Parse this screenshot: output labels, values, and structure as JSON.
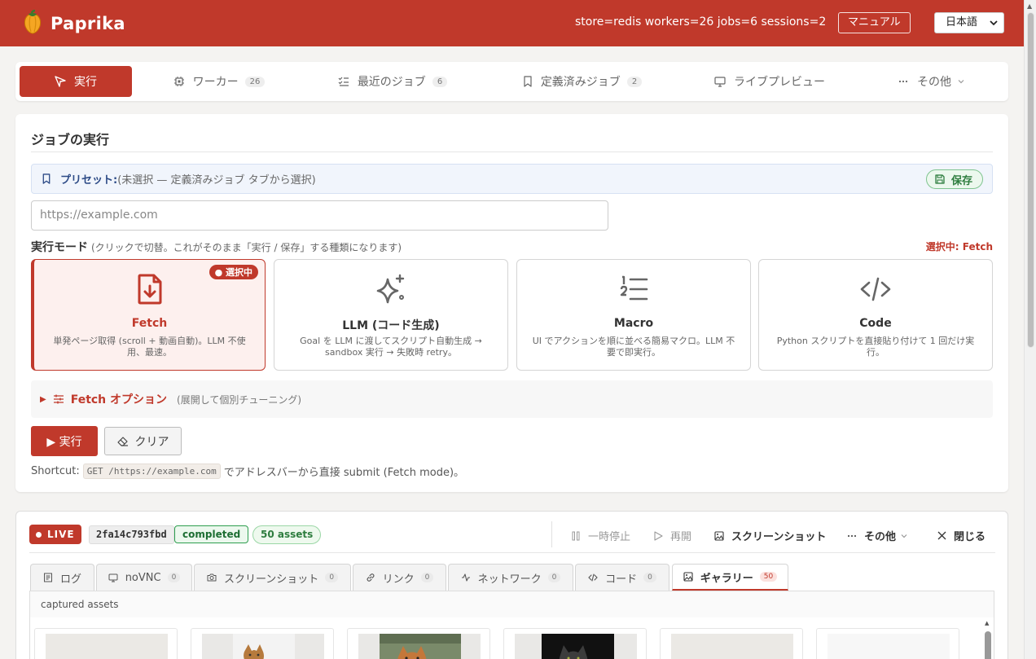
{
  "header": {
    "app_name": "Paprika",
    "stats": "store=redis workers=26 jobs=6 sessions=2",
    "manual_label": "マニュアル",
    "language": "日本語",
    "brand_color": "#c0392b"
  },
  "nav": {
    "tabs": [
      {
        "label": "実行",
        "icon": "send-icon",
        "active": true
      },
      {
        "label": "ワーカー",
        "icon": "cpu-icon",
        "count": "26"
      },
      {
        "label": "最近のジョブ",
        "icon": "list-check-icon",
        "count": "6"
      },
      {
        "label": "定義済みジョブ",
        "icon": "bookmark-icon",
        "count": "2"
      },
      {
        "label": "ライブプレビュー",
        "icon": "monitor-icon"
      },
      {
        "label": "その他",
        "icon": "ellipsis-icon"
      }
    ]
  },
  "run_panel": {
    "title": "ジョブの実行",
    "preset_label": "プリセット:",
    "preset_hint": "(未選択 — 定義済みジョブ タブから選択)",
    "save_label": "保存",
    "url_placeholder": "https://example.com",
    "mode_heading": "実行モード",
    "mode_hint": "(クリックで切替。これがそのまま「実行 / 保存」する種類になります)",
    "selected_text": "選択中: Fetch",
    "modes": [
      {
        "title": "Fetch",
        "desc": "単発ページ取得 (scroll + 動画自動)。LLM 不使用、最速。",
        "icon": "file-download-icon",
        "selected": true,
        "badge": "選択中"
      },
      {
        "title": "LLM (コード生成)",
        "desc": "Goal を LLM に渡してスクリプト自動生成 → sandbox 実行 → 失敗時 retry。",
        "icon": "sparkles-icon"
      },
      {
        "title": "Macro",
        "desc": "UI でアクションを順に並べる簡易マクロ。LLM 不要で即実行。",
        "icon": "list-ordered-icon"
      },
      {
        "title": "Code",
        "desc": "Python スクリプトを直接貼り付けて 1 回だけ実行。",
        "icon": "code-icon"
      }
    ],
    "fetch_options_title": "Fetch オプション",
    "fetch_options_hint": "(展開して個別チューニング)",
    "run_label": "▶ 実行",
    "clear_label": "クリア",
    "shortcut_prefix": "Shortcut:",
    "shortcut_code": "GET /https://example.com",
    "shortcut_suffix": "でアドレスバーから直接 submit (Fetch mode)。"
  },
  "live": {
    "badge": "LIVE",
    "job_id": "2fa14c793fbd",
    "status": "completed",
    "assets": "50 assets",
    "controls": {
      "pause": "一時停止",
      "resume": "再開",
      "screenshot": "スクリーンショット",
      "more": "その他",
      "close": "閉じる"
    },
    "tabs": [
      {
        "label": "ログ",
        "icon": "log-icon"
      },
      {
        "label": "noVNC",
        "icon": "monitor-icon",
        "count": "0"
      },
      {
        "label": "スクリーンショット",
        "icon": "camera-icon",
        "count": "0"
      },
      {
        "label": "リンク",
        "icon": "link-icon",
        "count": "0"
      },
      {
        "label": "ネットワーク",
        "icon": "activity-icon",
        "count": "0"
      },
      {
        "label": "コード",
        "icon": "code-icon",
        "count": "0"
      },
      {
        "label": "ギャラリー",
        "icon": "image-icon",
        "count": "50",
        "active": true
      }
    ],
    "caption": "captured assets"
  }
}
